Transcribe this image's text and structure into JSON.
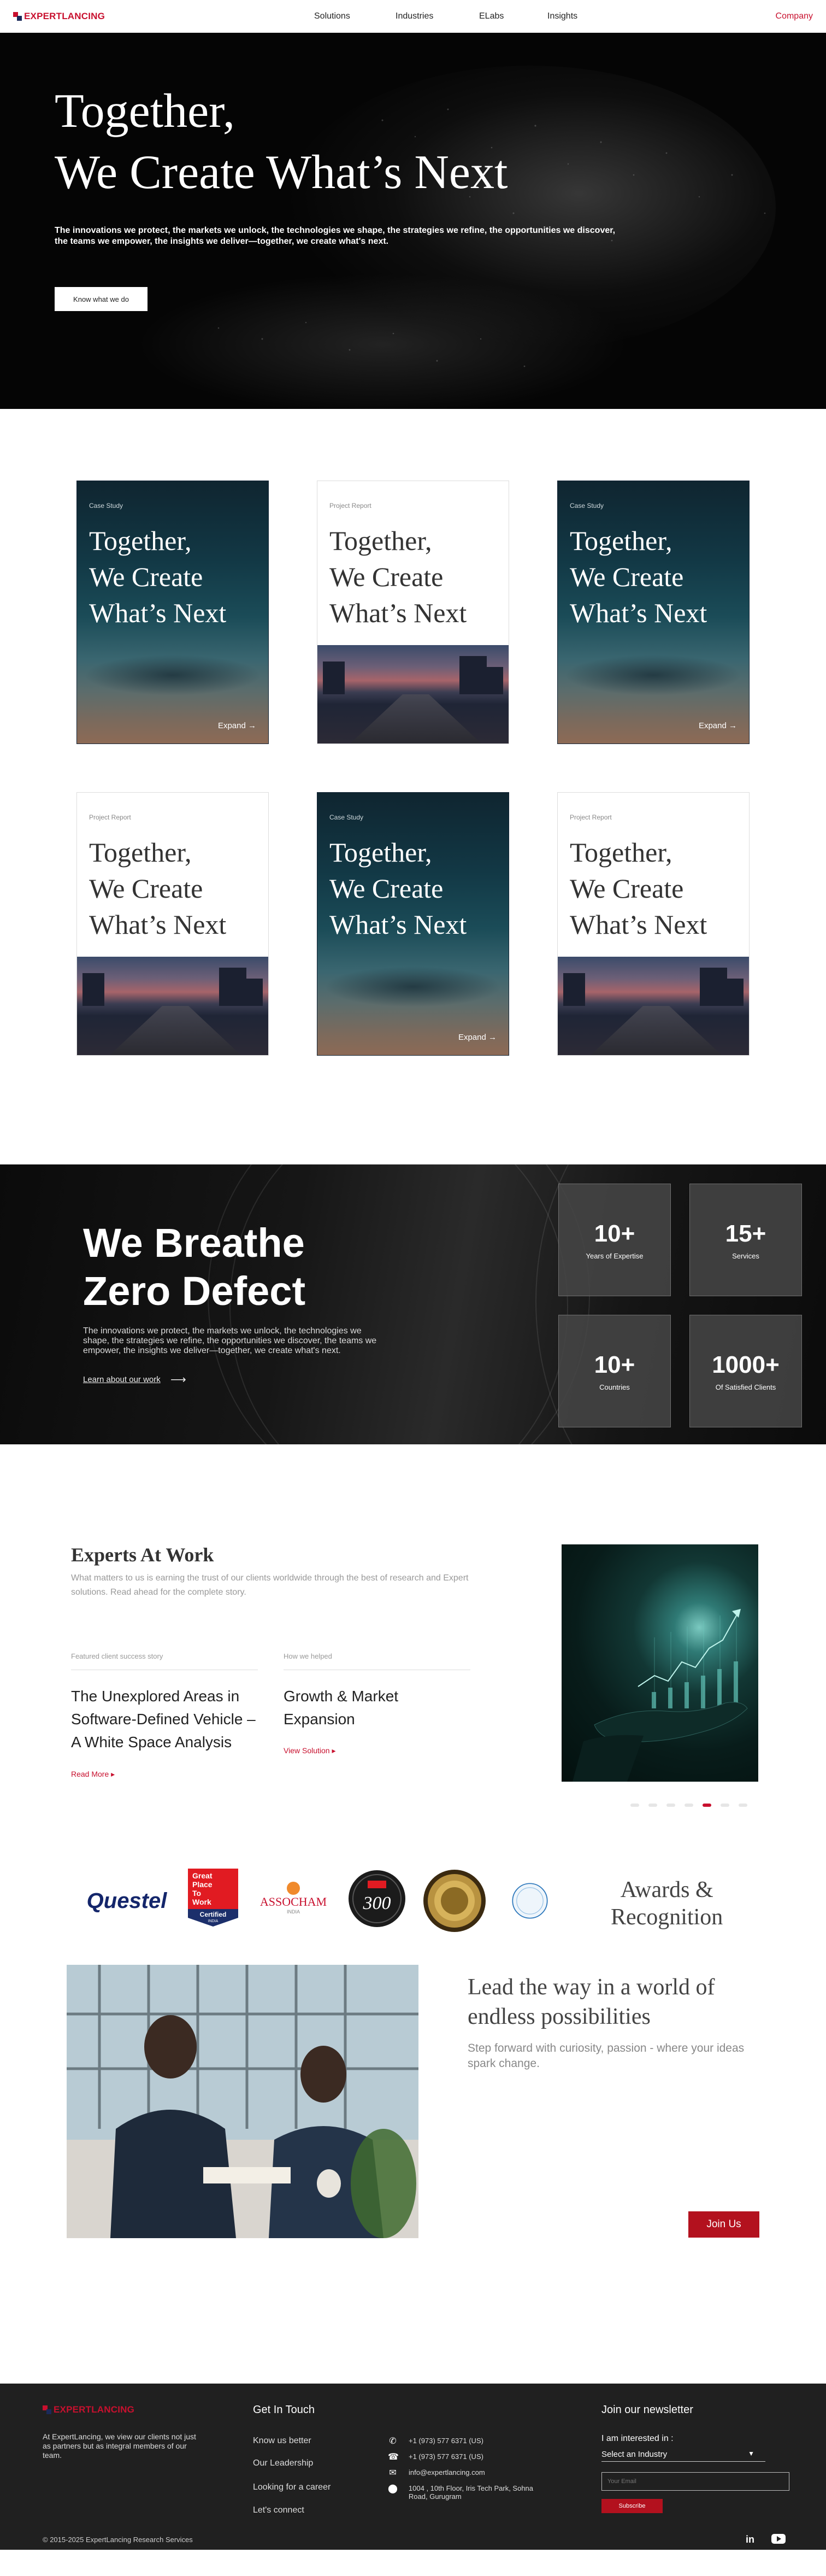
{
  "nav": {
    "logo": "EXPERTLANCING",
    "links": [
      "Solutions",
      "Industries",
      "ELabs",
      "Insights"
    ],
    "company": "Company"
  },
  "hero": {
    "title_line1": "Together,",
    "title_line2": "We Create What’s Next",
    "text": "The innovations we protect, the markets we unlock, the technologies we shape, the strategies we refine, the opportunities we discover, the teams we empower, the insights we deliver—together, we create what's next.",
    "button": "Know what we do"
  },
  "cards": [
    {
      "style": "dark",
      "tag": "Case Study",
      "title": [
        "Together,",
        "We Create",
        "What’s Next"
      ],
      "action": "Expand →"
    },
    {
      "style": "light",
      "tag": "Project Report",
      "title": [
        "Together,",
        "We Create",
        "What’s Next"
      ],
      "action": ""
    },
    {
      "style": "dark",
      "tag": "Case Study",
      "title": [
        "Together,",
        "We Create",
        "What’s Next"
      ],
      "action": "Expand →"
    },
    {
      "style": "light",
      "tag": "Project Report",
      "title": [
        "Together,",
        "We Create",
        "What’s Next"
      ],
      "action": ""
    },
    {
      "style": "dark",
      "tag": "Case Study",
      "title": [
        "Together,",
        "We Create",
        "What’s Next"
      ],
      "action": "Expand →"
    },
    {
      "style": "light",
      "tag": "Project Report",
      "title": [
        "Together,",
        "We Create",
        "What’s Next"
      ],
      "action": ""
    }
  ],
  "zero_defect": {
    "title_line1": "We Breathe",
    "title_line2": "Zero Defect",
    "text": "The innovations we protect, the markets we unlock, the technologies we shape, the strategies we refine, the opportunities we discover, the teams we empower, the insights we deliver—together, we create what's next.",
    "link": "Learn about our work",
    "stats": [
      {
        "value": "10+",
        "label": "Years of Expertise"
      },
      {
        "value": "15+",
        "label": "Services"
      },
      {
        "value": "10+",
        "label": "Countries"
      },
      {
        "value": "1000+",
        "label": "Of Satisfied Clients"
      }
    ]
  },
  "experts": {
    "title": "Experts At Work",
    "subtitle": "What matters to us is earning the trust of our clients worldwide through the best of research and Expert solutions. Read ahead for the complete story.",
    "featured": {
      "label": "Featured client success story",
      "headline": "The Unexplored Areas in Software-Defined Vehicle – A White Space Analysis",
      "link": "Read More"
    },
    "helped": {
      "label": "How we helped",
      "headline": "Growth & Market Expansion",
      "link": "View Solution"
    },
    "carousel_active": 5,
    "carousel_count": 8
  },
  "awards": {
    "title_line1": "Awards &",
    "title_line2": "Recognition",
    "logos": [
      "Questel",
      "Great Place To Work Certified",
      "ASSOCHAM",
      "300",
      "gold-seal",
      "blue-seal"
    ]
  },
  "badges": {
    "gptw_line1": "Great",
    "gptw_line2": "Place",
    "gptw_line3": "To",
    "gptw_line4": "Work",
    "gptw_cert": "Certified",
    "gptw_small": "INDIA",
    "assocham_name": "ASSOCHAM",
    "assocham_sub": "INDIA",
    "badge300": "300"
  },
  "lead": {
    "title_line1": "Lead the way in a world of",
    "title_line2": "endless possibilities",
    "text": "Step forward with curiosity, passion - where your ideas spark change.",
    "button": "Join Us"
  },
  "footer": {
    "logo": "EXPERTLANCING",
    "about": "At ExpertLancing, we view our clients not just as partners but as integral members of our team.",
    "contact_title": "Get In Touch",
    "links": [
      "Know us better",
      "Our Leadership",
      "Looking for a career",
      "Let's connect"
    ],
    "phone1": "+1 (973) 577 6371 (US)",
    "phone2": "+1 (973) 577 6371 (US)",
    "email": "info@expertlancing.com",
    "address": "1004 , 10th Floor, Iris Tech Park, Sohna Road, Gurugram",
    "newsletter_title": "Join our newsletter",
    "interest_label": "I am interested in :",
    "interest_value": "Select an Industry",
    "email_placeholder": "Your Email",
    "subscribe": "Subscribe",
    "copyright": "© 2015-2025 ExpertLancing Research Services",
    "social": [
      "in",
      "youtube"
    ]
  },
  "colors": {
    "brand_red": "#c8102e",
    "button_red": "#b3111e",
    "hero_bg": "#050505",
    "footer_bg": "#202020"
  }
}
